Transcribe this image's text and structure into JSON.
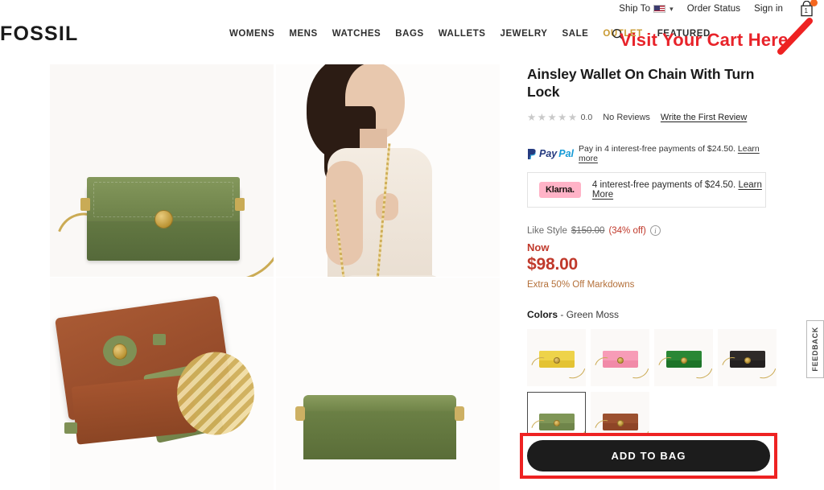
{
  "utility": {
    "ship_to": "Ship To",
    "flag": "us-flag-icon",
    "order_status": "Order Status",
    "sign_in": "Sign in",
    "cart_count": "1"
  },
  "brand": "FOSSIL",
  "nav": [
    {
      "label": "WOMENS",
      "accent": false
    },
    {
      "label": "MENS",
      "accent": false
    },
    {
      "label": "WATCHES",
      "accent": false
    },
    {
      "label": "BAGS",
      "accent": false
    },
    {
      "label": "WALLETS",
      "accent": false
    },
    {
      "label": "JEWELRY",
      "accent": false
    },
    {
      "label": "SALE",
      "accent": false
    },
    {
      "label": "OUTLET",
      "accent": true
    },
    {
      "label": "FEATURED",
      "accent": false
    }
  ],
  "annotation": {
    "text": "Visit Your Cart Here",
    "color": "#e8232a"
  },
  "gallery": {
    "images": [
      {
        "alt": "Green Moss wallet on chain front view"
      },
      {
        "alt": "Model wearing green crossbody wallet on chain"
      },
      {
        "alt": "Open wallet showing brown leather interior"
      },
      {
        "alt": "Green wallet top edge view"
      }
    ]
  },
  "product": {
    "title": "Ainsley Wallet On Chain With Turn Lock",
    "rating_value": "0.0",
    "rating_stars": 0,
    "no_reviews": "No Reviews",
    "write_review": "Write the First Review"
  },
  "paypal": {
    "logo_pay": "Pay",
    "logo_pal": "Pal",
    "copy": "Pay in 4 interest-free payments of $24.50.",
    "learn_more": "Learn more"
  },
  "klarna": {
    "logo": "Klarna.",
    "copy": "4 interest-free payments of $24.50.",
    "learn_more": "Learn More"
  },
  "price": {
    "like_style_label": "Like Style",
    "original": "$150.00",
    "percent_off": "(34% off)",
    "info_icon": "info-icon",
    "now_label": "Now",
    "now_price": "$98.00",
    "markdown_note": "Extra 50% Off Markdowns"
  },
  "colors": {
    "label": "Colors",
    "separator": "-",
    "selected": "Green Moss",
    "swatches": [
      {
        "name": "Yellow",
        "color": "#e8c93c",
        "selected": false
      },
      {
        "name": "Pink",
        "color": "#f490ad",
        "selected": false
      },
      {
        "name": "Green",
        "color": "#1f7a2e",
        "selected": false
      },
      {
        "name": "Black",
        "color": "#24201e",
        "selected": false
      },
      {
        "name": "Green Moss",
        "color": "#7c8f52",
        "selected": true
      },
      {
        "name": "Brown",
        "color": "#96462a",
        "selected": false
      }
    ]
  },
  "add_to_bag": {
    "label": "ADD TO BAG",
    "highlight_color": "#ee2222"
  },
  "feedback": {
    "label": "FEEDBACK"
  }
}
